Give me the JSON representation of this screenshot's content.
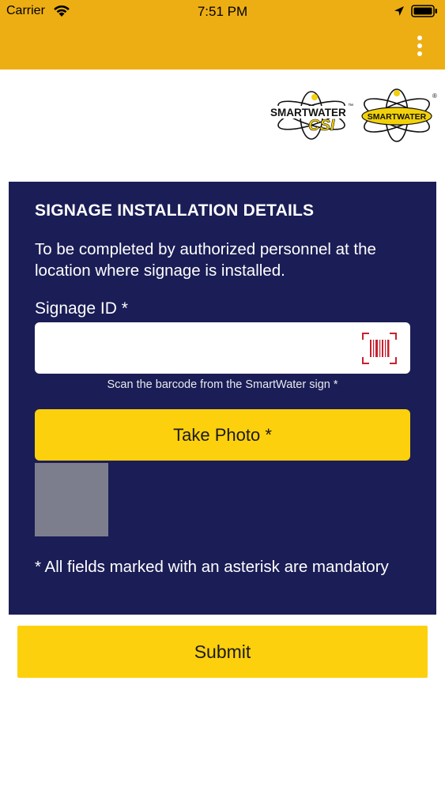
{
  "status_bar": {
    "carrier": "Carrier",
    "time": "7:51 PM"
  },
  "header": {
    "menu_icon": "more-vertical-icon",
    "color": "#EDAE14"
  },
  "logos": {
    "csi_text_top": "SMARTWATER",
    "csi_text_bottom": "CSI",
    "csi_tm": "™",
    "sw_text": "SMARTWATER",
    "sw_reg": "®"
  },
  "form": {
    "title": "SIGNAGE INSTALLATION DETAILS",
    "description": "To be completed by authorized personnel at the location where signage is installed.",
    "signage_id_label": "Signage ID *",
    "signage_id_value": "",
    "signage_id_placeholder": "",
    "barcode_icon": "barcode-scan-icon",
    "scan_hint": "Scan the barcode from the SmartWater sign *",
    "photo_button_label": "Take Photo *",
    "mandatory_note": "* All fields marked with an asterisk are mandatory",
    "card_color": "#1B1D56",
    "accent_color": "#FDD00D"
  },
  "submit_label": "Submit"
}
